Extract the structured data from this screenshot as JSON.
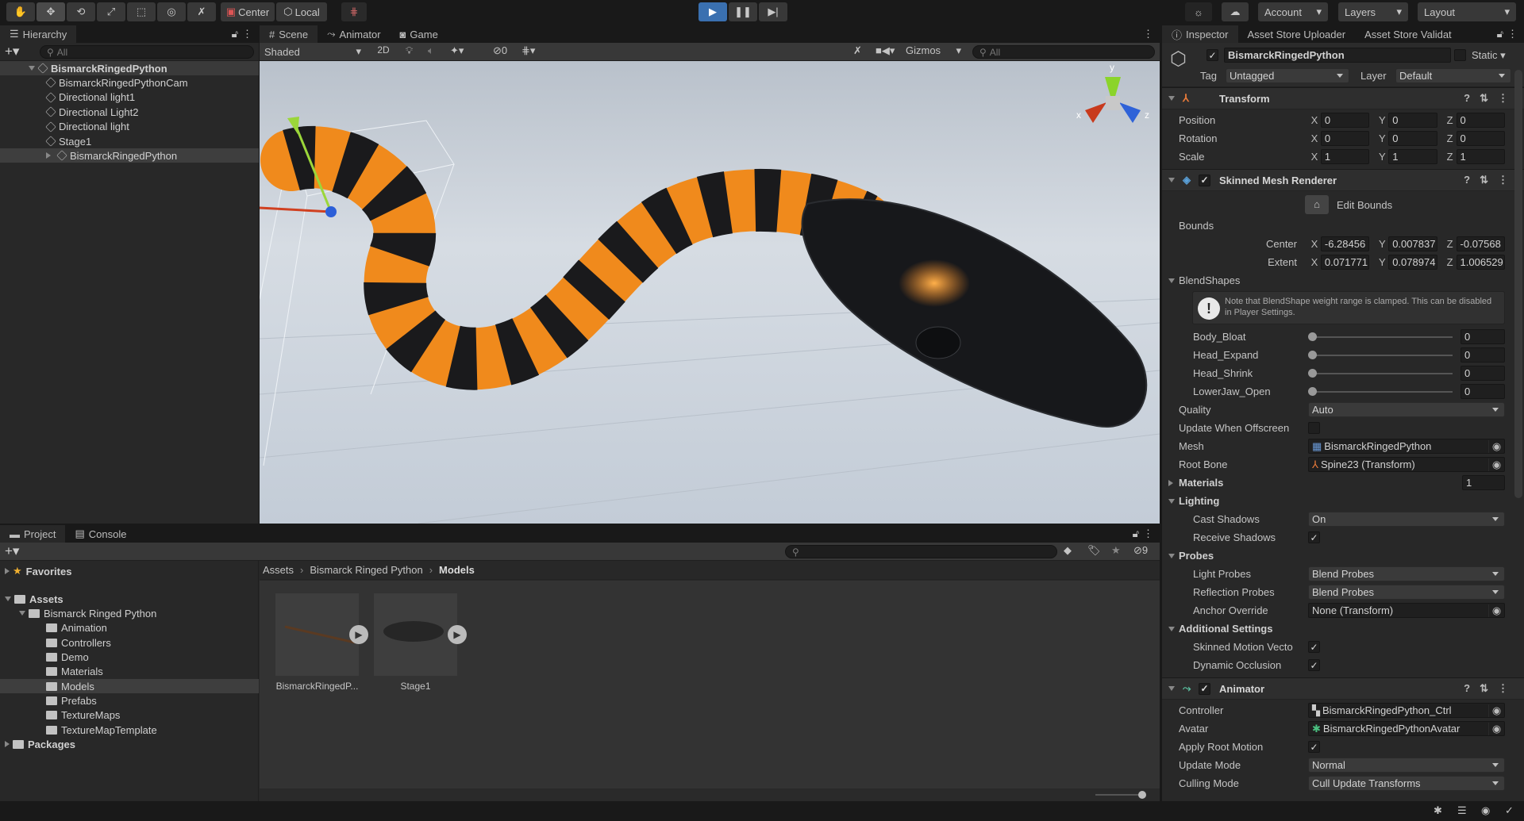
{
  "toolbar": {
    "tools": [
      "hand-tool",
      "move-tool",
      "rotate-tool",
      "scale-tool",
      "rect-tool",
      "transform-tool",
      "custom-tool"
    ],
    "pivot_label": "Center",
    "space_label": "Local",
    "account_label": "Account",
    "layers_label": "Layers",
    "layout_label": "Layout"
  },
  "hierarchy": {
    "tab": "Hierarchy",
    "search_placeholder": "All",
    "items": [
      {
        "label": "BismarckRingedPython",
        "depth": 0,
        "root": true
      },
      {
        "label": "BismarckRingedPythonCam",
        "depth": 1
      },
      {
        "label": "Directional light1",
        "depth": 1
      },
      {
        "label": "Directional Light2",
        "depth": 1
      },
      {
        "label": "Directional light",
        "depth": 1
      },
      {
        "label": "Stage1",
        "depth": 1
      },
      {
        "label": "BismarckRingedPython",
        "depth": 1,
        "collapsed": true,
        "selected": true
      }
    ]
  },
  "scene": {
    "tabs": [
      "Scene",
      "Animator",
      "Game"
    ],
    "shading": "Shaded",
    "mode_2d": "2D",
    "hidden_count": "0",
    "gizmos_label": "Gizmos",
    "search_placeholder": "All",
    "gizmo_axes": [
      "y",
      "x",
      "z"
    ],
    "colors": {
      "stripe_orange": "#f08a1c",
      "stripe_black": "#1a1a1c",
      "sky": "#c9d1da"
    }
  },
  "project": {
    "tabs": [
      "Project",
      "Console"
    ],
    "hidden_count": "9",
    "tree": [
      {
        "label": "Favorites",
        "depth": 0,
        "bold": true,
        "icon": "star"
      },
      {
        "label": "Assets",
        "depth": 0,
        "bold": true,
        "icon": "folder-open",
        "expanded": true
      },
      {
        "label": "Bismarck Ringed Python",
        "depth": 1,
        "icon": "folder-open",
        "expanded": true
      },
      {
        "label": "Animation",
        "depth": 2
      },
      {
        "label": "Controllers",
        "depth": 2
      },
      {
        "label": "Demo",
        "depth": 2
      },
      {
        "label": "Materials",
        "depth": 2
      },
      {
        "label": "Models",
        "depth": 2,
        "selected": true
      },
      {
        "label": "Prefabs",
        "depth": 2
      },
      {
        "label": "TextureMaps",
        "depth": 2
      },
      {
        "label": "TextureMapTemplate",
        "depth": 2
      },
      {
        "label": "Packages",
        "depth": 0,
        "bold": true
      }
    ],
    "breadcrumb": [
      "Assets",
      "Bismarck Ringed Python",
      "Models"
    ],
    "assets": [
      {
        "label": "BismarckRingedP..."
      },
      {
        "label": "Stage1"
      }
    ]
  },
  "inspector": {
    "tabs": [
      "Inspector",
      "Asset Store Uploader",
      "Asset Store Validat"
    ],
    "object_name": "BismarckRingedPython",
    "active": true,
    "static_label": "Static",
    "tag_label": "Tag",
    "tag_value": "Untagged",
    "layer_label": "Layer",
    "layer_value": "Default",
    "components": [
      {
        "title": "Transform",
        "icon": "transform-icon",
        "has_toggle": false,
        "rows": [
          {
            "type": "vec3",
            "label": "Position",
            "values": [
              "0",
              "0",
              "0"
            ]
          },
          {
            "type": "vec3",
            "label": "Rotation",
            "values": [
              "0",
              "0",
              "0"
            ]
          },
          {
            "type": "vec3",
            "label": "Scale",
            "values": [
              "1",
              "1",
              "1"
            ]
          }
        ]
      },
      {
        "title": "Skinned Mesh Renderer",
        "icon": "skinned-mesh-icon",
        "has_toggle": true,
        "rows": [
          {
            "type": "button",
            "label": "Edit Bounds"
          },
          {
            "type": "label",
            "label": "Bounds"
          },
          {
            "type": "vec3",
            "label": "Center",
            "right": true,
            "values": [
              "-6.28456",
              "0.007837",
              "-0.07568"
            ]
          },
          {
            "type": "vec3",
            "label": "Extent",
            "right": true,
            "values": [
              "0.071771",
              "0.078974",
              "1.006529"
            ]
          },
          {
            "type": "foldout",
            "label": "BlendShapes",
            "bold": false
          },
          {
            "type": "help",
            "label": "Note that BlendShape weight range is clamped. This can be disabled in Player Settings."
          },
          {
            "type": "slider",
            "label": "Body_Bloat",
            "value": "0",
            "indent": true
          },
          {
            "type": "slider",
            "label": "Head_Expand",
            "value": "0",
            "indent": true
          },
          {
            "type": "slider",
            "label": "Head_Shrink",
            "value": "0",
            "indent": true
          },
          {
            "type": "slider",
            "label": "LowerJaw_Open",
            "value": "0",
            "indent": true
          },
          {
            "type": "dropdown",
            "label": "Quality",
            "value": "Auto"
          },
          {
            "type": "check",
            "label": "Update When Offscreen",
            "checked": false
          },
          {
            "type": "object",
            "label": "Mesh",
            "value": "BismarckRingedPython",
            "icon": "mesh-icon"
          },
          {
            "type": "object",
            "label": "Root Bone",
            "value": "Spine23 (Transform)",
            "icon": "transform-icon"
          },
          {
            "type": "foldcount",
            "label": "Materials",
            "value": "1"
          },
          {
            "type": "foldout",
            "label": "Lighting",
            "bold": true
          },
          {
            "type": "dropdown",
            "label": "Cast Shadows",
            "value": "On",
            "indent": true
          },
          {
            "type": "check",
            "label": "Receive Shadows",
            "checked": true,
            "indent": true
          },
          {
            "type": "foldout",
            "label": "Probes",
            "bold": true
          },
          {
            "type": "dropdown",
            "label": "Light Probes",
            "value": "Blend Probes",
            "indent": true
          },
          {
            "type": "dropdown",
            "label": "Reflection Probes",
            "value": "Blend Probes",
            "indent": true
          },
          {
            "type": "object",
            "label": "Anchor Override",
            "value": "None (Transform)",
            "indent": true
          },
          {
            "type": "foldout",
            "label": "Additional Settings",
            "bold": true
          },
          {
            "type": "check",
            "label": "Skinned Motion Vecto",
            "checked": true,
            "indent": true
          },
          {
            "type": "check",
            "label": "Dynamic Occlusion",
            "checked": true,
            "indent": true
          }
        ]
      },
      {
        "title": "Animator",
        "icon": "animator-icon",
        "has_toggle": true,
        "rows": [
          {
            "type": "object",
            "label": "Controller",
            "value": "BismarckRingedPython_Ctrl",
            "icon": "controller-icon"
          },
          {
            "type": "object",
            "label": "Avatar",
            "value": "BismarckRingedPythonAvatar",
            "icon": "avatar-icon"
          },
          {
            "type": "check",
            "label": "Apply Root Motion",
            "checked": true
          },
          {
            "type": "dropdown",
            "label": "Update Mode",
            "value": "Normal"
          },
          {
            "type": "dropdown",
            "label": "Culling Mode",
            "value": "Cull Update Transforms"
          }
        ]
      }
    ]
  }
}
